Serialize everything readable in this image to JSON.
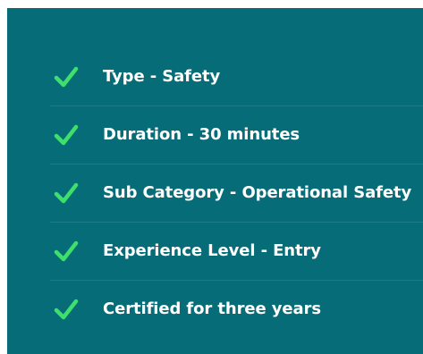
{
  "colors": {
    "panel_background": "#066c78",
    "check": "#3ee06b",
    "text": "#ffffff"
  },
  "features": [
    {
      "icon": "check-icon",
      "label": "Type - Safety"
    },
    {
      "icon": "check-icon",
      "label": "Duration - 30 minutes"
    },
    {
      "icon": "check-icon",
      "label": "Sub Category - Operational Safety"
    },
    {
      "icon": "check-icon",
      "label": "Experience Level - Entry"
    },
    {
      "icon": "check-icon",
      "label": "Certified for three years"
    }
  ]
}
